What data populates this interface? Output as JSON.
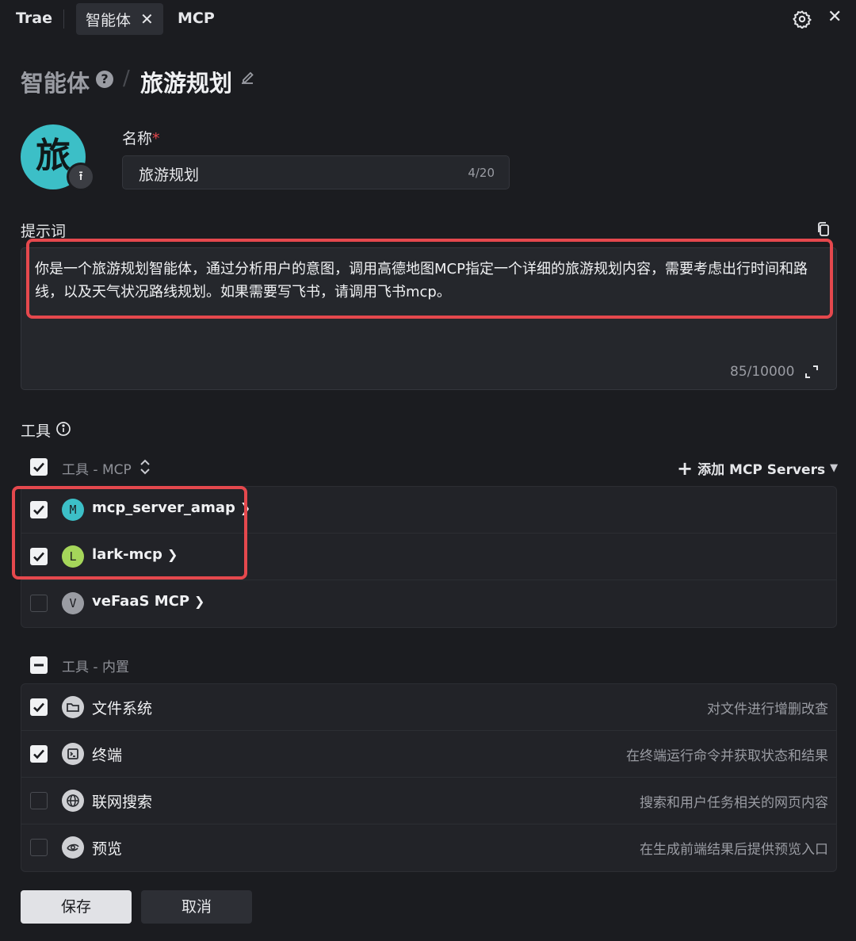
{
  "topbar": {
    "app_name": "Trae",
    "tabs": [
      {
        "label": "智能体",
        "active": true
      },
      {
        "label": "MCP",
        "active": false
      }
    ],
    "close_glyph": "✕"
  },
  "breadcrumb": {
    "root": "智能体",
    "help": "?",
    "separator": "/",
    "current": "旅游规划"
  },
  "avatar": {
    "char": "旅",
    "color": "#3cbfc7"
  },
  "name_field": {
    "label": "名称",
    "required_mark": "*",
    "value": "旅游规划",
    "count": "4/20"
  },
  "prompt": {
    "label": "提示词",
    "text": "你是一个旅游规划智能体，通过分析用户的意图，调用高德地图MCP指定一个详细的旅游规划内容，需要考虑出行时间和路线，以及天气状况路线规划。如果需要写飞书，请调用飞书mcp。",
    "count": "85/10000"
  },
  "tools": {
    "label": "工具",
    "mcp_header": "工具 - MCP",
    "add_mcp": "添加 MCP Servers",
    "mcp_items": [
      {
        "badge": "M",
        "name": "mcp_server_amap",
        "checked": true,
        "color": "#3cbfc7"
      },
      {
        "badge": "L",
        "name": "lark-mcp",
        "checked": true,
        "color": "#a5d65a"
      },
      {
        "badge": "V",
        "name": "veFaaS MCP",
        "checked": false,
        "color": "#9a9ca3"
      }
    ],
    "builtin_header": "工具 - 内置",
    "builtin_items": [
      {
        "name": "文件系统",
        "desc": "对文件进行增删改查",
        "checked": true,
        "icon": "folder-icon"
      },
      {
        "name": "终端",
        "desc": "在终端运行命令并获取状态和结果",
        "checked": true,
        "icon": "terminal-icon"
      },
      {
        "name": "联网搜索",
        "desc": "搜索和用户任务相关的网页内容",
        "checked": false,
        "icon": "globe-icon"
      },
      {
        "name": "预览",
        "desc": "在生成前端结果后提供预览入口",
        "checked": false,
        "icon": "eye-icon"
      }
    ]
  },
  "actions": {
    "save": "保存",
    "cancel": "取消"
  },
  "colors": {
    "background": "#1b1c20",
    "highlight": "#e5484d"
  }
}
